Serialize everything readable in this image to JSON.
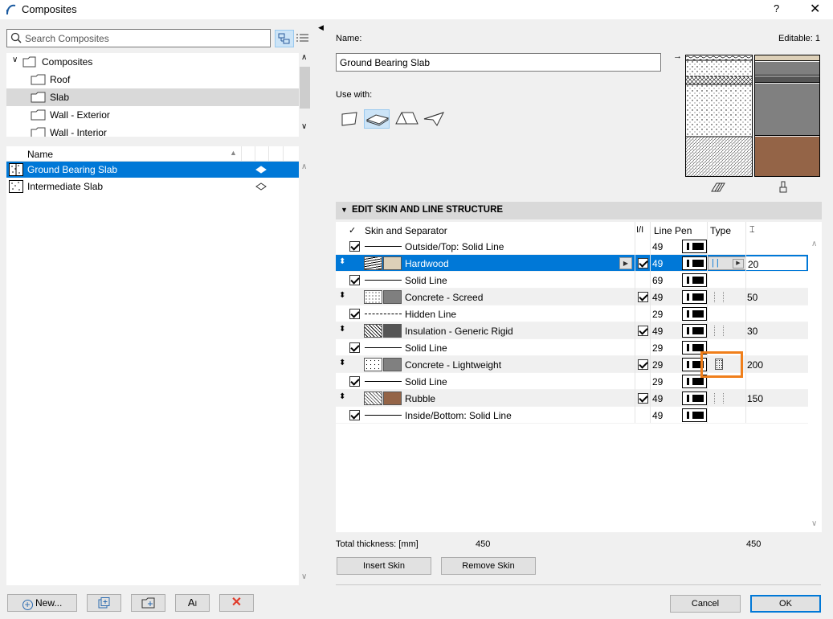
{
  "window": {
    "title": "Composites",
    "help": "?",
    "close": "✕"
  },
  "search": {
    "placeholder": "Search Composites"
  },
  "tree": {
    "root": "Composites",
    "items": [
      "Roof",
      "Slab",
      "Wall - Exterior",
      "Wall - Interior"
    ],
    "selected": "Slab"
  },
  "list": {
    "header": "Name",
    "items": [
      {
        "name": "Ground Bearing Slab",
        "selected": true
      },
      {
        "name": "Intermediate Slab",
        "selected": false
      }
    ]
  },
  "left_buttons": {
    "new": "New...",
    "dup_icon": "duplicate-icon",
    "folder_icon": "new-folder-icon",
    "rename_icon": "rename-icon",
    "delete_icon": "delete-icon"
  },
  "details": {
    "name_label": "Name:",
    "editable": "Editable: 1",
    "name_value": "Ground Bearing Slab",
    "use_with": "Use with:"
  },
  "section": {
    "title": "EDIT SKIN AND LINE STRUCTURE"
  },
  "columns": {
    "skin": "Skin and Separator",
    "vis": "I/I",
    "linepen": "Line Pen",
    "type": "Type"
  },
  "rows": [
    {
      "kind": "line",
      "name": "Outside/Top: Solid Line",
      "pen": "49",
      "thick": ""
    },
    {
      "kind": "skin",
      "name": "Hardwood",
      "pen": "49",
      "thick": "20",
      "color": "#ddd0b8",
      "selected": true
    },
    {
      "kind": "line",
      "name": "Solid Line",
      "pen": "69",
      "thick": ""
    },
    {
      "kind": "skin",
      "name": "Concrete - Screed",
      "pen": "49",
      "thick": "50",
      "color": "#7f7f7f"
    },
    {
      "kind": "dash",
      "name": "Hidden Line",
      "pen": "29",
      "thick": ""
    },
    {
      "kind": "skin",
      "name": "Insulation - Generic Rigid",
      "pen": "49",
      "thick": "30",
      "color": "#555555"
    },
    {
      "kind": "line",
      "name": "Solid Line",
      "pen": "29",
      "thick": ""
    },
    {
      "kind": "skin",
      "name": "Concrete - Lightweight",
      "pen": "29",
      "thick": "200",
      "color": "#808080"
    },
    {
      "kind": "line",
      "name": "Solid Line",
      "pen": "29",
      "thick": ""
    },
    {
      "kind": "skin",
      "name": "Rubble",
      "pen": "49",
      "thick": "150",
      "color": "#946447"
    },
    {
      "kind": "line",
      "name": "Inside/Bottom: Solid Line",
      "pen": "49",
      "thick": ""
    }
  ],
  "totals": {
    "label": "Total thickness: [mm]",
    "value1": "450",
    "value2": "450"
  },
  "actions": {
    "insert": "Insert Skin",
    "remove": "Remove Skin",
    "cancel": "Cancel",
    "ok": "OK"
  }
}
